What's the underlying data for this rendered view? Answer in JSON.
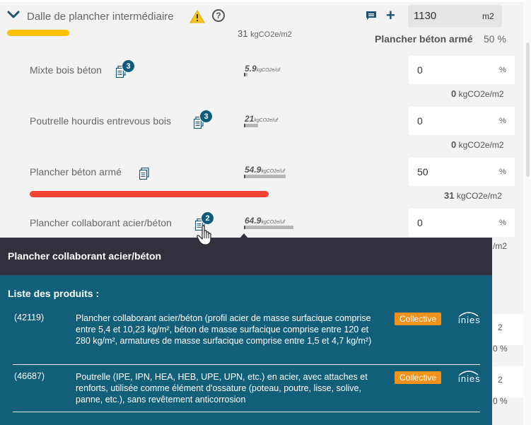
{
  "section": {
    "title": "Dalle de plancher intermédiaire",
    "warning_icon": "warning-icon",
    "help_icon": "help-icon",
    "help_text": "?",
    "impact_value": "31",
    "impact_unit": "kgCO2e/m2",
    "area_value": "1130",
    "area_unit": "m2",
    "main_material": "Plancher béton armé",
    "main_percent": "50 %",
    "colors": {
      "accent": "#1a5575",
      "yellow": "#ffc107",
      "red": "#f44336",
      "badge": "#0f5b7b"
    }
  },
  "rows": [
    {
      "label": "Mixte bois béton",
      "badge": "3",
      "impact": "5.9",
      "impact_unit": "kgCO2e/uf",
      "percent": "0",
      "percent_unit": "%",
      "result": "0",
      "result_unit": "kgCO2e/m2"
    },
    {
      "label": "Poutrelle hourdis entrevous bois",
      "badge": "3",
      "impact": "21",
      "impact_unit": "kgCO2e/uf",
      "percent": "0",
      "percent_unit": "%",
      "result": "0",
      "result_unit": "kgCO2e/m2"
    },
    {
      "label": "Plancher béton armé",
      "badge": "",
      "impact": "54.9",
      "impact_unit": "kgCO2e/uf",
      "percent": "50",
      "percent_unit": "%",
      "result": "31",
      "result_unit": "kgCO2e/m2"
    },
    {
      "label": "Plancher collaborant acier/béton",
      "badge": "2",
      "impact": "64.9",
      "impact_unit": "kgCO2e/uf",
      "percent": "0",
      "percent_unit": "%",
      "result": "",
      "result_unit": "/m2"
    }
  ],
  "background_fragments": {
    "unit_a": "2",
    "pct_a": "0 %",
    "unit_b": "2",
    "pct_b": "0 %"
  },
  "popover": {
    "title": "Plancher collaborant acier/béton",
    "subtitle": "Liste des produits :",
    "products": [
      {
        "id": "(42119)",
        "description": "Plancher collaborant acier/béton (profil acier de masse surfacique comprise entre 5,4 et 10,23 kg/m², béton de masse surfacique comprise entre 120 et 280 kg/m², armatures de masse surfacique comprise entre 1,5 et 4,7 kg/m²)",
        "tag": "Collective",
        "source": "inies"
      },
      {
        "id": "(46687)",
        "description": "Poutrelle (IPE, IPN, HEA, HEB, UPE, UPN, etc.) en acier, avec attaches et renforts, utilisée comme élément d'ossature (poteau, poutre, lisse, solive, panne, etc.), sans revêtement anticorrosion",
        "tag": "Collective",
        "source": "inies"
      }
    ]
  }
}
